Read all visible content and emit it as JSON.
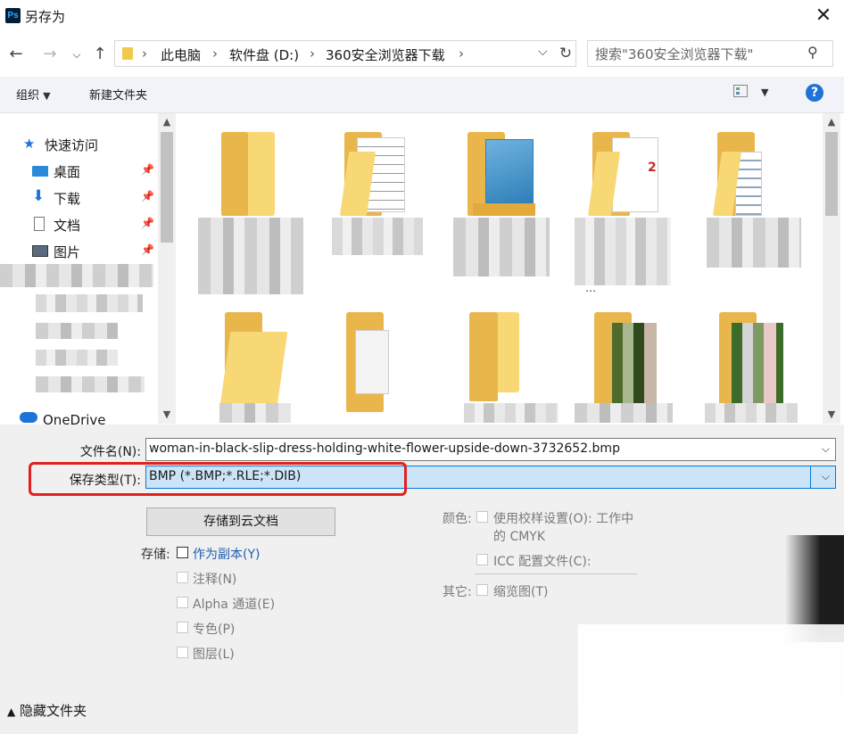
{
  "window": {
    "title": "另存为",
    "app_badge": "Ps"
  },
  "address": {
    "segments": [
      "此电脑",
      "软件盘 (D:)",
      "360安全浏览器下载"
    ]
  },
  "search": {
    "placeholder": "搜索\"360安全浏览器下载\""
  },
  "toolbar": {
    "organize": "组织",
    "new_folder": "新建文件夹",
    "help": "?"
  },
  "nav": {
    "quick_access": "快速访问",
    "items": [
      {
        "label": "桌面",
        "icon": "desktop-icon"
      },
      {
        "label": "下载",
        "icon": "download-icon"
      },
      {
        "label": "文档",
        "icon": "document-icon"
      },
      {
        "label": "图片",
        "icon": "pictures-icon"
      }
    ],
    "onedrive": "OneDrive"
  },
  "files": {
    "partial_caption": "…"
  },
  "form": {
    "filename_label": "文件名(N):",
    "filename_value": "woman-in-black-slip-dress-holding-white-flower-upside-down-3732652.bmp",
    "type_label": "保存类型(T):",
    "type_value": "BMP (*.BMP;*.RLE;*.DIB)",
    "cloud_button": "存储到云文档",
    "storage_label": "存储:",
    "as_copy": "作为副本(Y)",
    "notes": "注释(N)",
    "alpha": "Alpha 通道(E)",
    "spot": "专色(P)",
    "layers": "图层(L)",
    "color_label": "颜色:",
    "proof": "使用校样设置(O):  工作中",
    "proof2": "的 CMYK",
    "icc": "ICC 配置文件(C):",
    "other_label": "其它:",
    "thumbnail": "缩览图(T)"
  },
  "footer": {
    "hide_folders": "隐藏文件夹"
  }
}
